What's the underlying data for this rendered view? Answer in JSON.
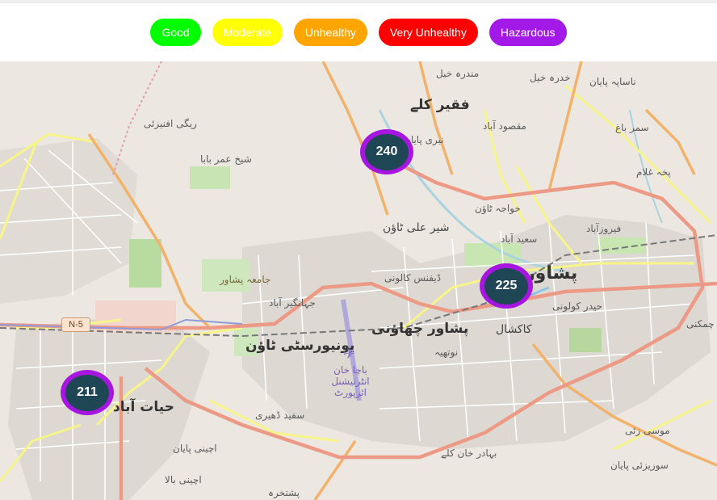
{
  "legend": [
    {
      "label": "Good",
      "color": "#00ff00"
    },
    {
      "label": "Moderate",
      "color": "#ffff00"
    },
    {
      "label": "Unhealthy",
      "color": "#ffa500"
    },
    {
      "label": "Very Unhealthy",
      "color": "#ff0000"
    },
    {
      "label": "Hazardous",
      "color": "#a31ae8"
    }
  ],
  "markers": [
    {
      "value": "240",
      "category": "Hazardous"
    },
    {
      "value": "225",
      "category": "Hazardous"
    },
    {
      "value": "211",
      "category": "Hazardous"
    }
  ],
  "map": {
    "road_shield": "N-5",
    "labels": {
      "mandra_khel": "مندرہ خیل",
      "khadra_khel": "خدرہ خیل",
      "nasapa_payan": "ناساپہ پایان",
      "faqir_kalay": "فقیر کلے",
      "regi_afeezai": "ریگی افنیزئی",
      "nabi_payan": "نبری پایان",
      "maqsood_abad": "مقصود آباد",
      "samar_bagh": "سمر باغ",
      "sheikh_umar_baba": "شیخ عمر بابا",
      "pakha_ghulam": "پخہ غلام",
      "khwaja_town": "خواجہ ٹاؤن",
      "sher_ali_town": "شیر علی ٹاؤن",
      "firozabad": "فیروزآباد",
      "saeedabad": "سعید آباد",
      "jamia_peshawar": "جامعہ پشاور",
      "defence_colony": "ڈیفنس کالونی",
      "peshawar": "پشاور",
      "jahangirabad": "جہانگیر آباد",
      "haider_colony": "حیدر کولونی",
      "peshawar_cantt": "پشاور چھاؤنی",
      "kakshal": "کاکشال",
      "university_town": "یونیورسٹی ٹاؤن",
      "nothia": "نوتھیہ",
      "bacha_khan_airport": "باچا خان انٹرنیشنل ائرپورٹ",
      "hayatabad": "حیات آباد",
      "saeed_dheri": "سفید ڈھیری",
      "bahadar_khan_kalay": "بہادر خان کلے",
      "musa_zai": "موسی زئی",
      "achini_payan": "اچینی پایان",
      "achini_bala": "اچینی بالا",
      "pashtakhara": "پشتخرہ",
      "surezai_payan": "سوزیزئی پایان",
      "chamkani": "چمکنی"
    }
  }
}
